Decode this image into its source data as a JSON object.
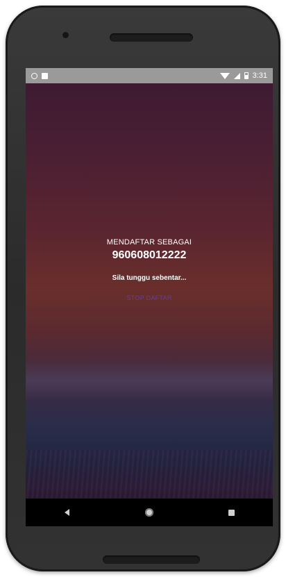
{
  "status_bar": {
    "time": "3:31",
    "left_icons": [
      "sync-icon",
      "notification-icon"
    ],
    "right_icons": [
      "wifi-icon",
      "signal-icon",
      "battery-icon"
    ]
  },
  "registration": {
    "label": "MENDAFTAR SEBAGAI",
    "number": "960608012222",
    "wait_text": "Sila tunggu sebentar...",
    "action_link": "STOP DAFTAR"
  },
  "nav_bar": {
    "icons": [
      "back-icon",
      "home-icon",
      "recents-icon"
    ]
  },
  "colors": {
    "status_bar": "#9a9a9a",
    "nav_bar": "#000000",
    "link": "#6a3fb0"
  }
}
